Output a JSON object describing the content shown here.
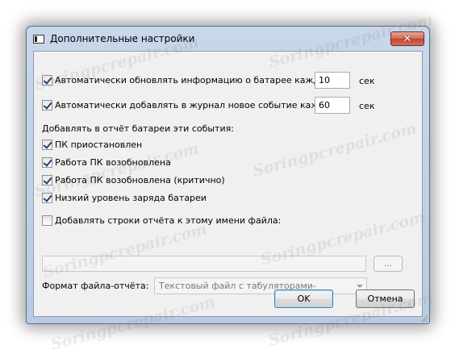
{
  "window": {
    "title": "Дополнительные настройки",
    "close_symbol": "✕",
    "watermark": "Soringpcrepair.com"
  },
  "settings": {
    "auto_update": {
      "label": "Автоматически обновлять информацию о батарее каждые",
      "checked": true,
      "value": "10",
      "unit": "сек"
    },
    "auto_log": {
      "label": "Автоматически добавлять в журнал новое событие каждые",
      "checked": true,
      "value": "60",
      "unit": "сек"
    }
  },
  "events": {
    "heading": "Добавлять в отчёт батареи эти события:",
    "items": [
      {
        "label": "ПК приостановлен",
        "checked": true
      },
      {
        "label": "Работа ПК возобновлена",
        "checked": true
      },
      {
        "label": "Работа ПК возобновлена (критично)",
        "checked": true
      },
      {
        "label": "Низкий уровень заряда батареи",
        "checked": true
      }
    ]
  },
  "file": {
    "append_label": "Добавлять строки отчёта к этому имени файла:",
    "append_checked": false,
    "path_value": "",
    "browse_label": "...",
    "format_label": "Формат файла-отчёта:",
    "format_value": "Текстовый файл с табуляторами-разделителями"
  },
  "buttons": {
    "ok": "OK",
    "cancel": "Отмена"
  }
}
